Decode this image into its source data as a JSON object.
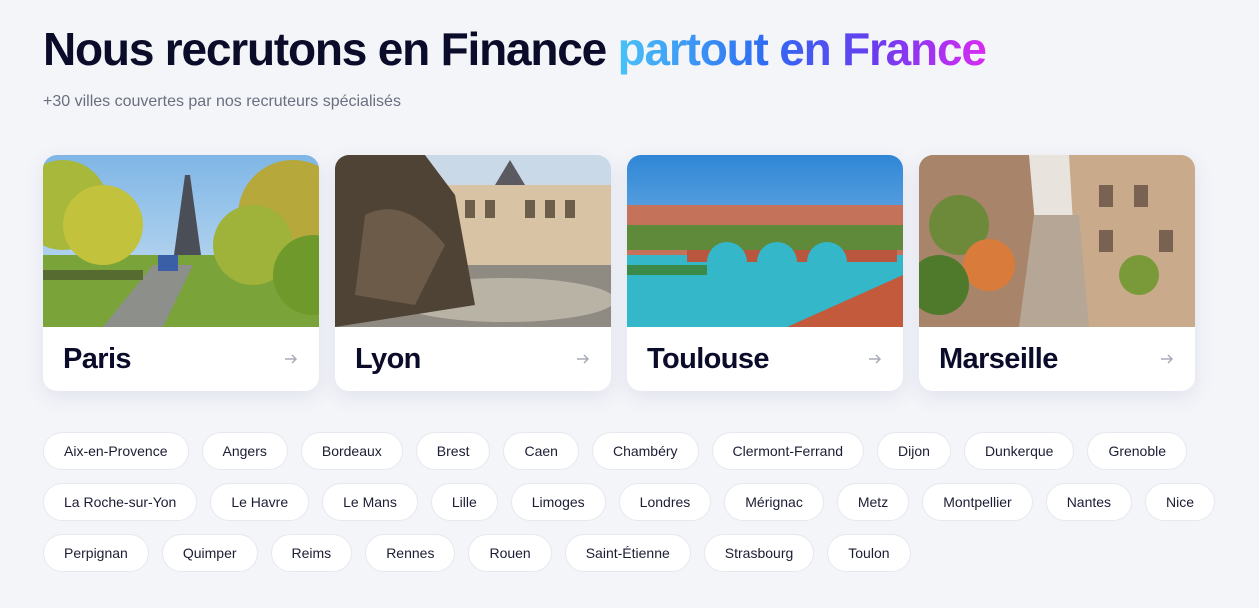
{
  "header": {
    "title_plain": "Nous recrutons en Finance",
    "title_accent": "partout en France",
    "subtitle": "+30 villes couvertes par nos recruteurs spécialisés"
  },
  "featured_cities": [
    {
      "name": "Paris"
    },
    {
      "name": "Lyon"
    },
    {
      "name": "Toulouse"
    },
    {
      "name": "Marseille"
    }
  ],
  "city_chips": {
    "row1": [
      "Aix-en-Provence",
      "Angers",
      "Bordeaux",
      "Brest",
      "Caen",
      "Chambéry",
      "Clermont-Ferrand",
      "Dijon",
      "Dunkerque",
      "Grenoble"
    ],
    "row2": [
      "La Roche-sur-Yon",
      "Le Havre",
      "Le Mans",
      "Lille",
      "Limoges",
      "Londres",
      "Mérignac",
      "Metz",
      "Montpellier",
      "Nantes",
      "Nice"
    ],
    "row3": [
      "Perpignan",
      "Quimper",
      "Reims",
      "Rennes",
      "Rouen",
      "Saint-Étienne",
      "Strasbourg",
      "Toulon"
    ]
  },
  "colors": {
    "background": "#f4f5f9",
    "text": "#0b0c2a",
    "gradient_start": "#49c2f7",
    "gradient_end": "#d92bf2"
  },
  "icons": {
    "card_arrow": "arrow-right-icon"
  }
}
